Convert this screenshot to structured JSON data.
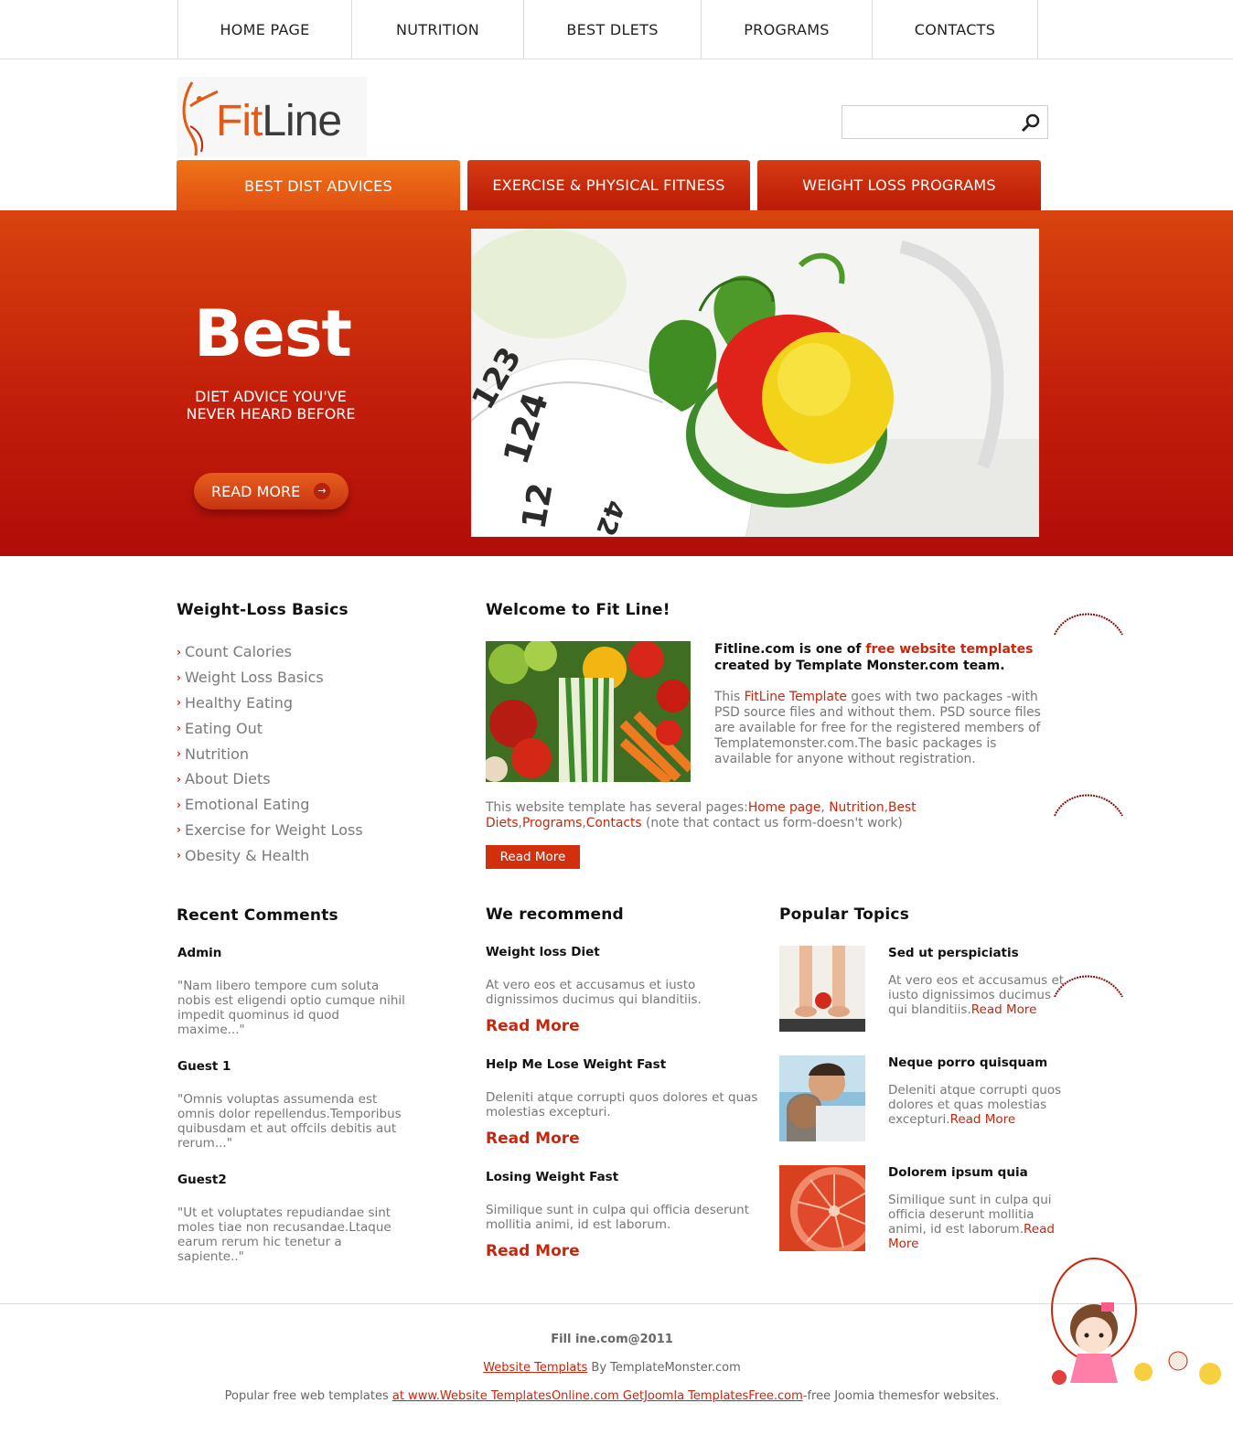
{
  "nav": {
    "items": [
      {
        "label": "HOME PAGE"
      },
      {
        "label": "NUTRITION"
      },
      {
        "label": "BEST DLETS"
      },
      {
        "label": "PROGRAMS"
      },
      {
        "label": "CONTACTS"
      }
    ]
  },
  "logo": {
    "part1": "Fit",
    "part2": "Line"
  },
  "search": {
    "value": "",
    "placeholder": ""
  },
  "tabs": [
    {
      "label": "BEST DIST ADVICES"
    },
    {
      "label": "EXERCISE & PHYSICAL FITNESS"
    },
    {
      "label": "WEIGHT LOSS PROGRAMS"
    }
  ],
  "hero": {
    "title": "Best",
    "subtitle": "DIET ADVICE YOU'VE NEVER HEARD BEFORE",
    "button_label": "READ MORE",
    "image_text": {
      "tape1": "123",
      "tape2": "124",
      "tape3": "12",
      "tape4": "42"
    }
  },
  "sidebar": {
    "title": "Weight-Loss Basics",
    "items": [
      "Count Calories",
      "Weight Loss Basics",
      "Healthy Eating",
      "Eating Out",
      "Nutrition",
      "About Diets",
      "Emotional Eating",
      "Exercise for Weight Loss",
      "Obesity & Health"
    ]
  },
  "welcome": {
    "title": "Welcome to Fit Line!",
    "lead1": "Fitline.com is one of ",
    "lead_link": "free website templates",
    "lead2": " created by Template Monster.com team.",
    "body1": "This ",
    "body_link": "FitLine Template",
    "body2": " goes with two packages -with PSD source files and without them. PSD source files are available for free for the registered members of Templatemonster.com.The basic packages is available for anyone without registration.",
    "pages1": "This website template has several pages:",
    "pages_links": [
      "Home page",
      "Nutrition",
      "Best Diets",
      "Programs",
      "Contacts"
    ],
    "pages2": " (note that contact us form-doesn't work)",
    "button": "Read More"
  },
  "comments": {
    "title": "Recent Comments",
    "items": [
      {
        "author": "Admin",
        "text": "\"Nam libero tempore cum soluta nobis est eligendi optio cumque nihil impedit quominus id quod maxime...\""
      },
      {
        "author": "Guest 1",
        "text": "\"Omnis voluptas assumenda est omnis dolor repellendus.Temporibus quibusdam et aut offcils debitis aut rerum...\""
      },
      {
        "author": "Guest2",
        "text": "\"Ut et voluptates repudiandae sint moles tiae non recusandae.Ltaque earum rerum hic tenetur a sapiente..\""
      }
    ]
  },
  "recommend": {
    "title": "We recommend",
    "items": [
      {
        "title": "Weight loss Diet",
        "text": "At vero eos et accusamus et iusto dignissimos ducimus qui blanditiis.",
        "more": "Read More"
      },
      {
        "title": "Help Me Lose Weight Fast",
        "text": "Deleniti atque corrupti quos dolores et quas molestias excepturi.",
        "more": "Read More"
      },
      {
        "title": "Losing Weight Fast",
        "text": "Similique sunt in culpa qui officia deserunt mollitia animi, id est laborum.",
        "more": "Read More"
      }
    ]
  },
  "popular": {
    "title": "Popular Topics",
    "items": [
      {
        "title": "Sed ut perspiciatis",
        "text": "At vero eos et accusamus et iusto dignissimos ducimus qui blanditiis.",
        "more": "Read More"
      },
      {
        "title": "Neque porro quisquam",
        "text": "Deleniti atque corrupti quos dolores et quas molestias excepturi.",
        "more": "Read More"
      },
      {
        "title": "Dolorem ipsum quia",
        "text": "Similique sunt in culpa qui officia deserunt mollitia animi, id est laborum.",
        "more": "Read More"
      }
    ]
  },
  "footer": {
    "copyright": "Fill ine.com@2011",
    "credit_link": "Website Templats",
    "credit_text": " By TemplateMonster.com",
    "popular_text1": "Popular free web templates ",
    "popular_link": "at www.Website TemplatesOnline.com GetJoomla TemplatesFree.com",
    "popular_text2": "-free Joomia themesfor websites."
  },
  "colors": {
    "accent": "#c8260d",
    "orange": "#e35a14",
    "hero_red": "#c21e0b"
  }
}
